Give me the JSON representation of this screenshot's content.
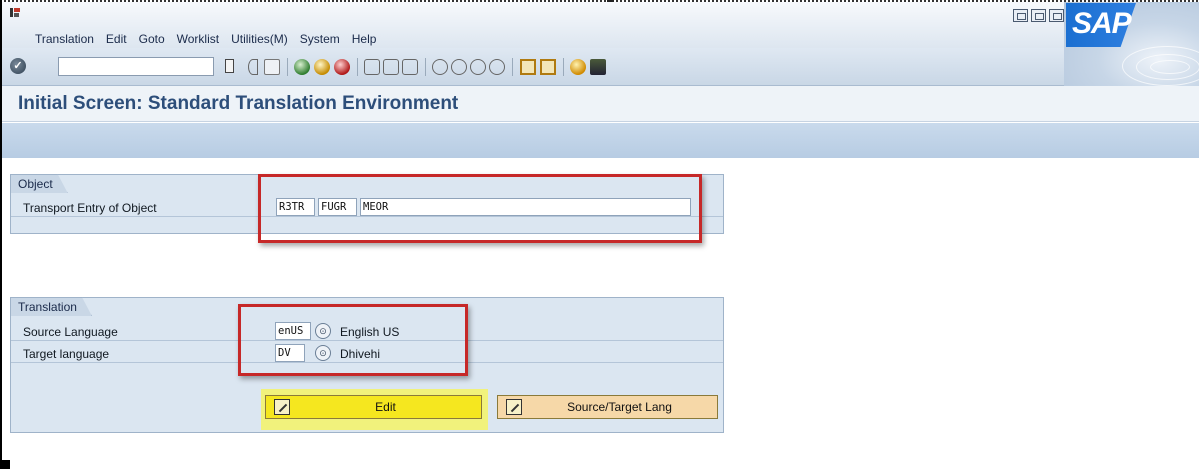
{
  "menu": {
    "items": [
      "Translation",
      "Edit",
      "Goto",
      "Worklist",
      "Utilities(M)",
      "System",
      "Help"
    ]
  },
  "branding": {
    "logo_text": "SAP"
  },
  "toolbar": {
    "command_value": "",
    "icons": [
      "enter-icon",
      "save-icon",
      "back-icon",
      "exit-icon",
      "cancel-icon",
      "print-icon",
      "find-icon",
      "find-next-icon",
      "first-page-icon",
      "previous-page-icon",
      "next-page-icon",
      "last-page-icon",
      "create-session-icon",
      "shortcut-icon",
      "help-icon",
      "layout-icon"
    ]
  },
  "page": {
    "title": "Initial Screen: Standard Translation Environment"
  },
  "object_group": {
    "tab_label": "Object",
    "transport_label": "Transport Entry of Object",
    "pgmid": "R3TR",
    "object_type": "FUGR",
    "object_name": "MEOR"
  },
  "translation_group": {
    "tab_label": "Translation",
    "source_label": "Source Language",
    "source_code": "enUS",
    "source_name": "English US",
    "target_label": "Target language",
    "target_code": "DV",
    "target_name": "Dhivehi"
  },
  "buttons": {
    "edit_label": "Edit",
    "source_target_label": "Source/Target Lang"
  },
  "colors": {
    "title": "#2d4e7a",
    "highlight_red": "#c62828",
    "highlight_yellow": "#f1f27c",
    "group_bg": "#dbe6f1"
  }
}
